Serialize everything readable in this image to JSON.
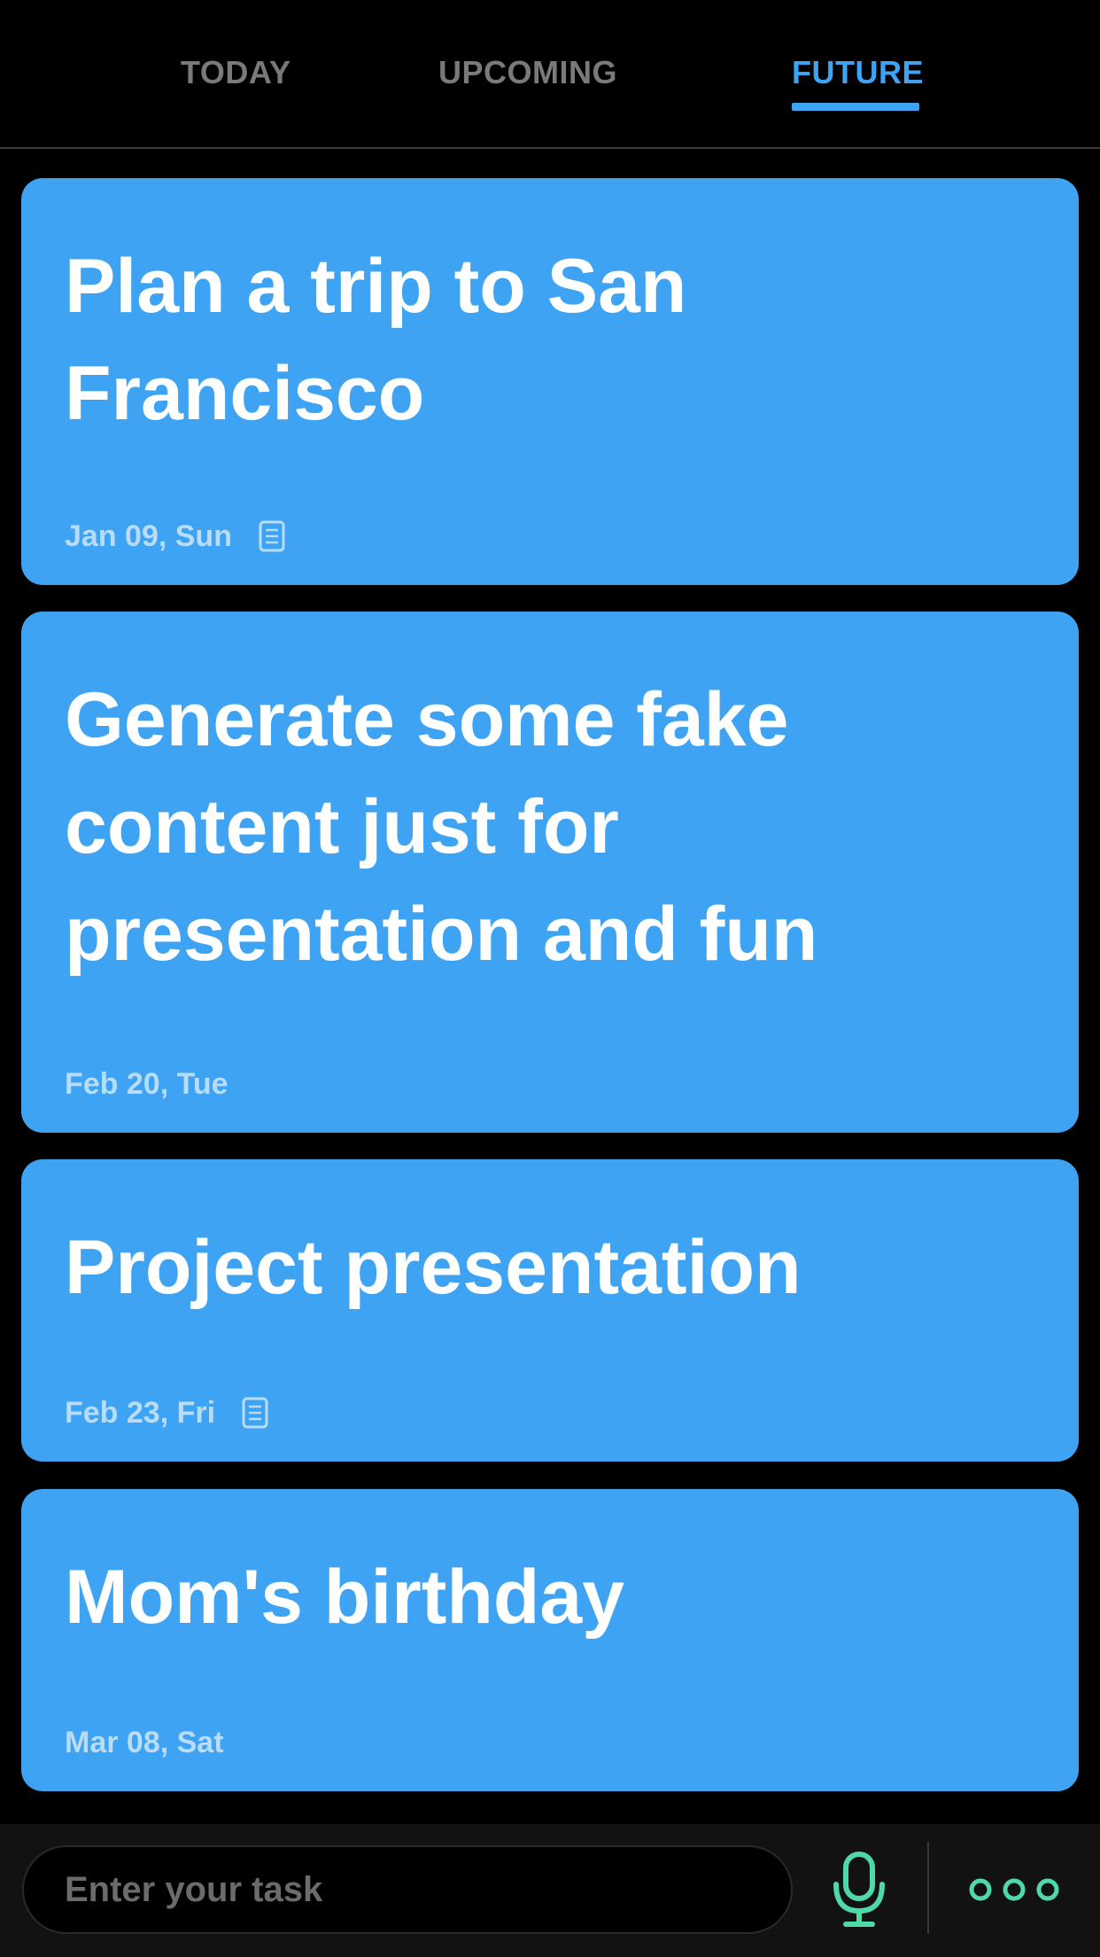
{
  "tabs": [
    {
      "label": "TODAY",
      "active": false
    },
    {
      "label": "UPCOMING",
      "active": false
    },
    {
      "label": "FUTURE",
      "active": true
    }
  ],
  "colors": {
    "accent": "#3da3f2",
    "card_bg": "#3da3f2",
    "date_text": "#b8dcf9",
    "icon_green": "#4fd9a8",
    "inactive_tab": "#7a7a7a",
    "background": "#000000"
  },
  "cards": [
    {
      "title": "Plan a trip to San Francisco",
      "date": "Jan 09, Sun",
      "has_note": true,
      "note_icon": "note-icon"
    },
    {
      "title": "Generate some fake content just for presentation and fun",
      "date": "Feb 20, Tue",
      "has_note": false
    },
    {
      "title": "Project presentation",
      "date": "Feb 23, Fri",
      "has_note": true,
      "note_icon": "note-icon"
    },
    {
      "title": "Mom's birthday",
      "date": "Mar 08, Sat",
      "has_note": false
    }
  ],
  "bottom_bar": {
    "input_placeholder": "Enter your task",
    "input_value": "",
    "mic_icon": "microphone-icon",
    "more_icon": "more-dots-icon"
  }
}
